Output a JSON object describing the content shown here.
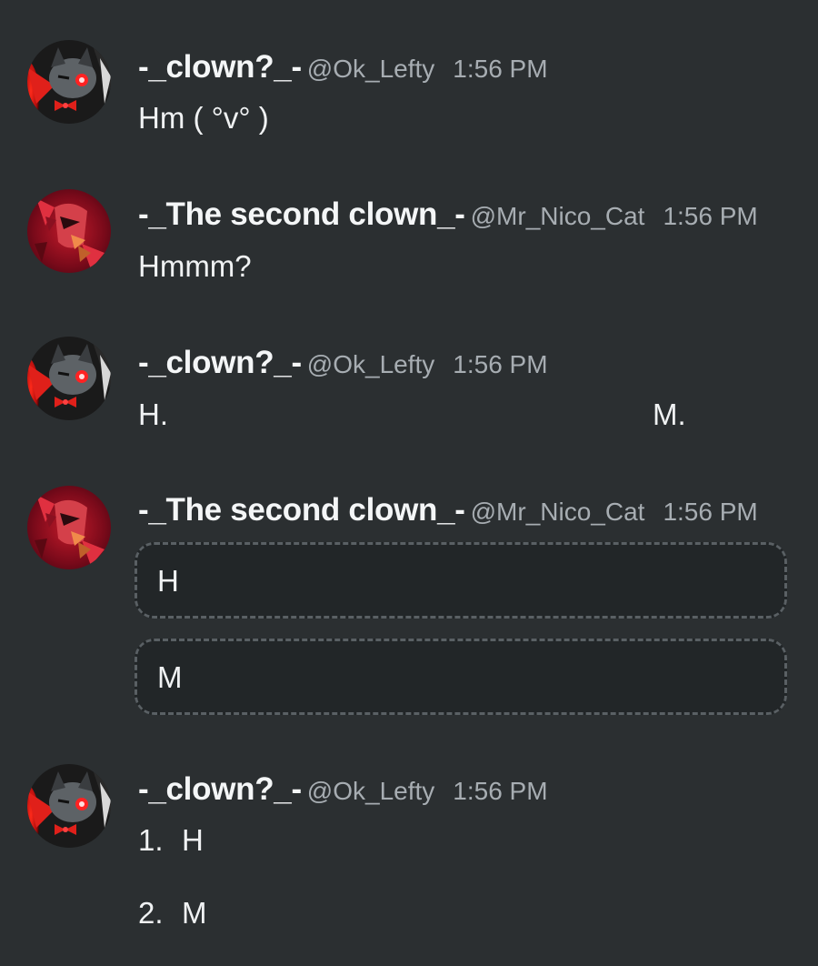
{
  "messages": [
    {
      "author": "-_clown?_-",
      "handle": "@Ok_Lefty",
      "time": "1:56 PM",
      "text": "Hm ( °v° )",
      "avatar_icon": "clown-cat-avatar-icon"
    },
    {
      "author": "-_The second clown_-",
      "handle": "@Mr_Nico_Cat",
      "time": "1:56 PM",
      "text": "Hmmm?",
      "avatar_icon": "red-demon-avatar-icon"
    },
    {
      "author": "-_clown?_-",
      "handle": "@Ok_Lefty",
      "time": "1:56 PM",
      "text_left": "H.",
      "text_right": "M."
    },
    {
      "author": "-_The second clown_-",
      "handle": "@Mr_Nico_Cat",
      "time": "1:56 PM",
      "blocks": [
        "H",
        "M"
      ]
    },
    {
      "author": "-_clown?_-",
      "handle": "@Ok_Lefty",
      "time": "1:56 PM",
      "list": [
        {
          "num": "1.",
          "text": "H"
        },
        {
          "num": "2.",
          "text": "M"
        }
      ]
    }
  ],
  "colors": {
    "background": "#2b2f31",
    "name": "#f4f6f7",
    "meta": "#a7adb2",
    "block_border": "#5a6064",
    "block_fill": "#222628"
  }
}
